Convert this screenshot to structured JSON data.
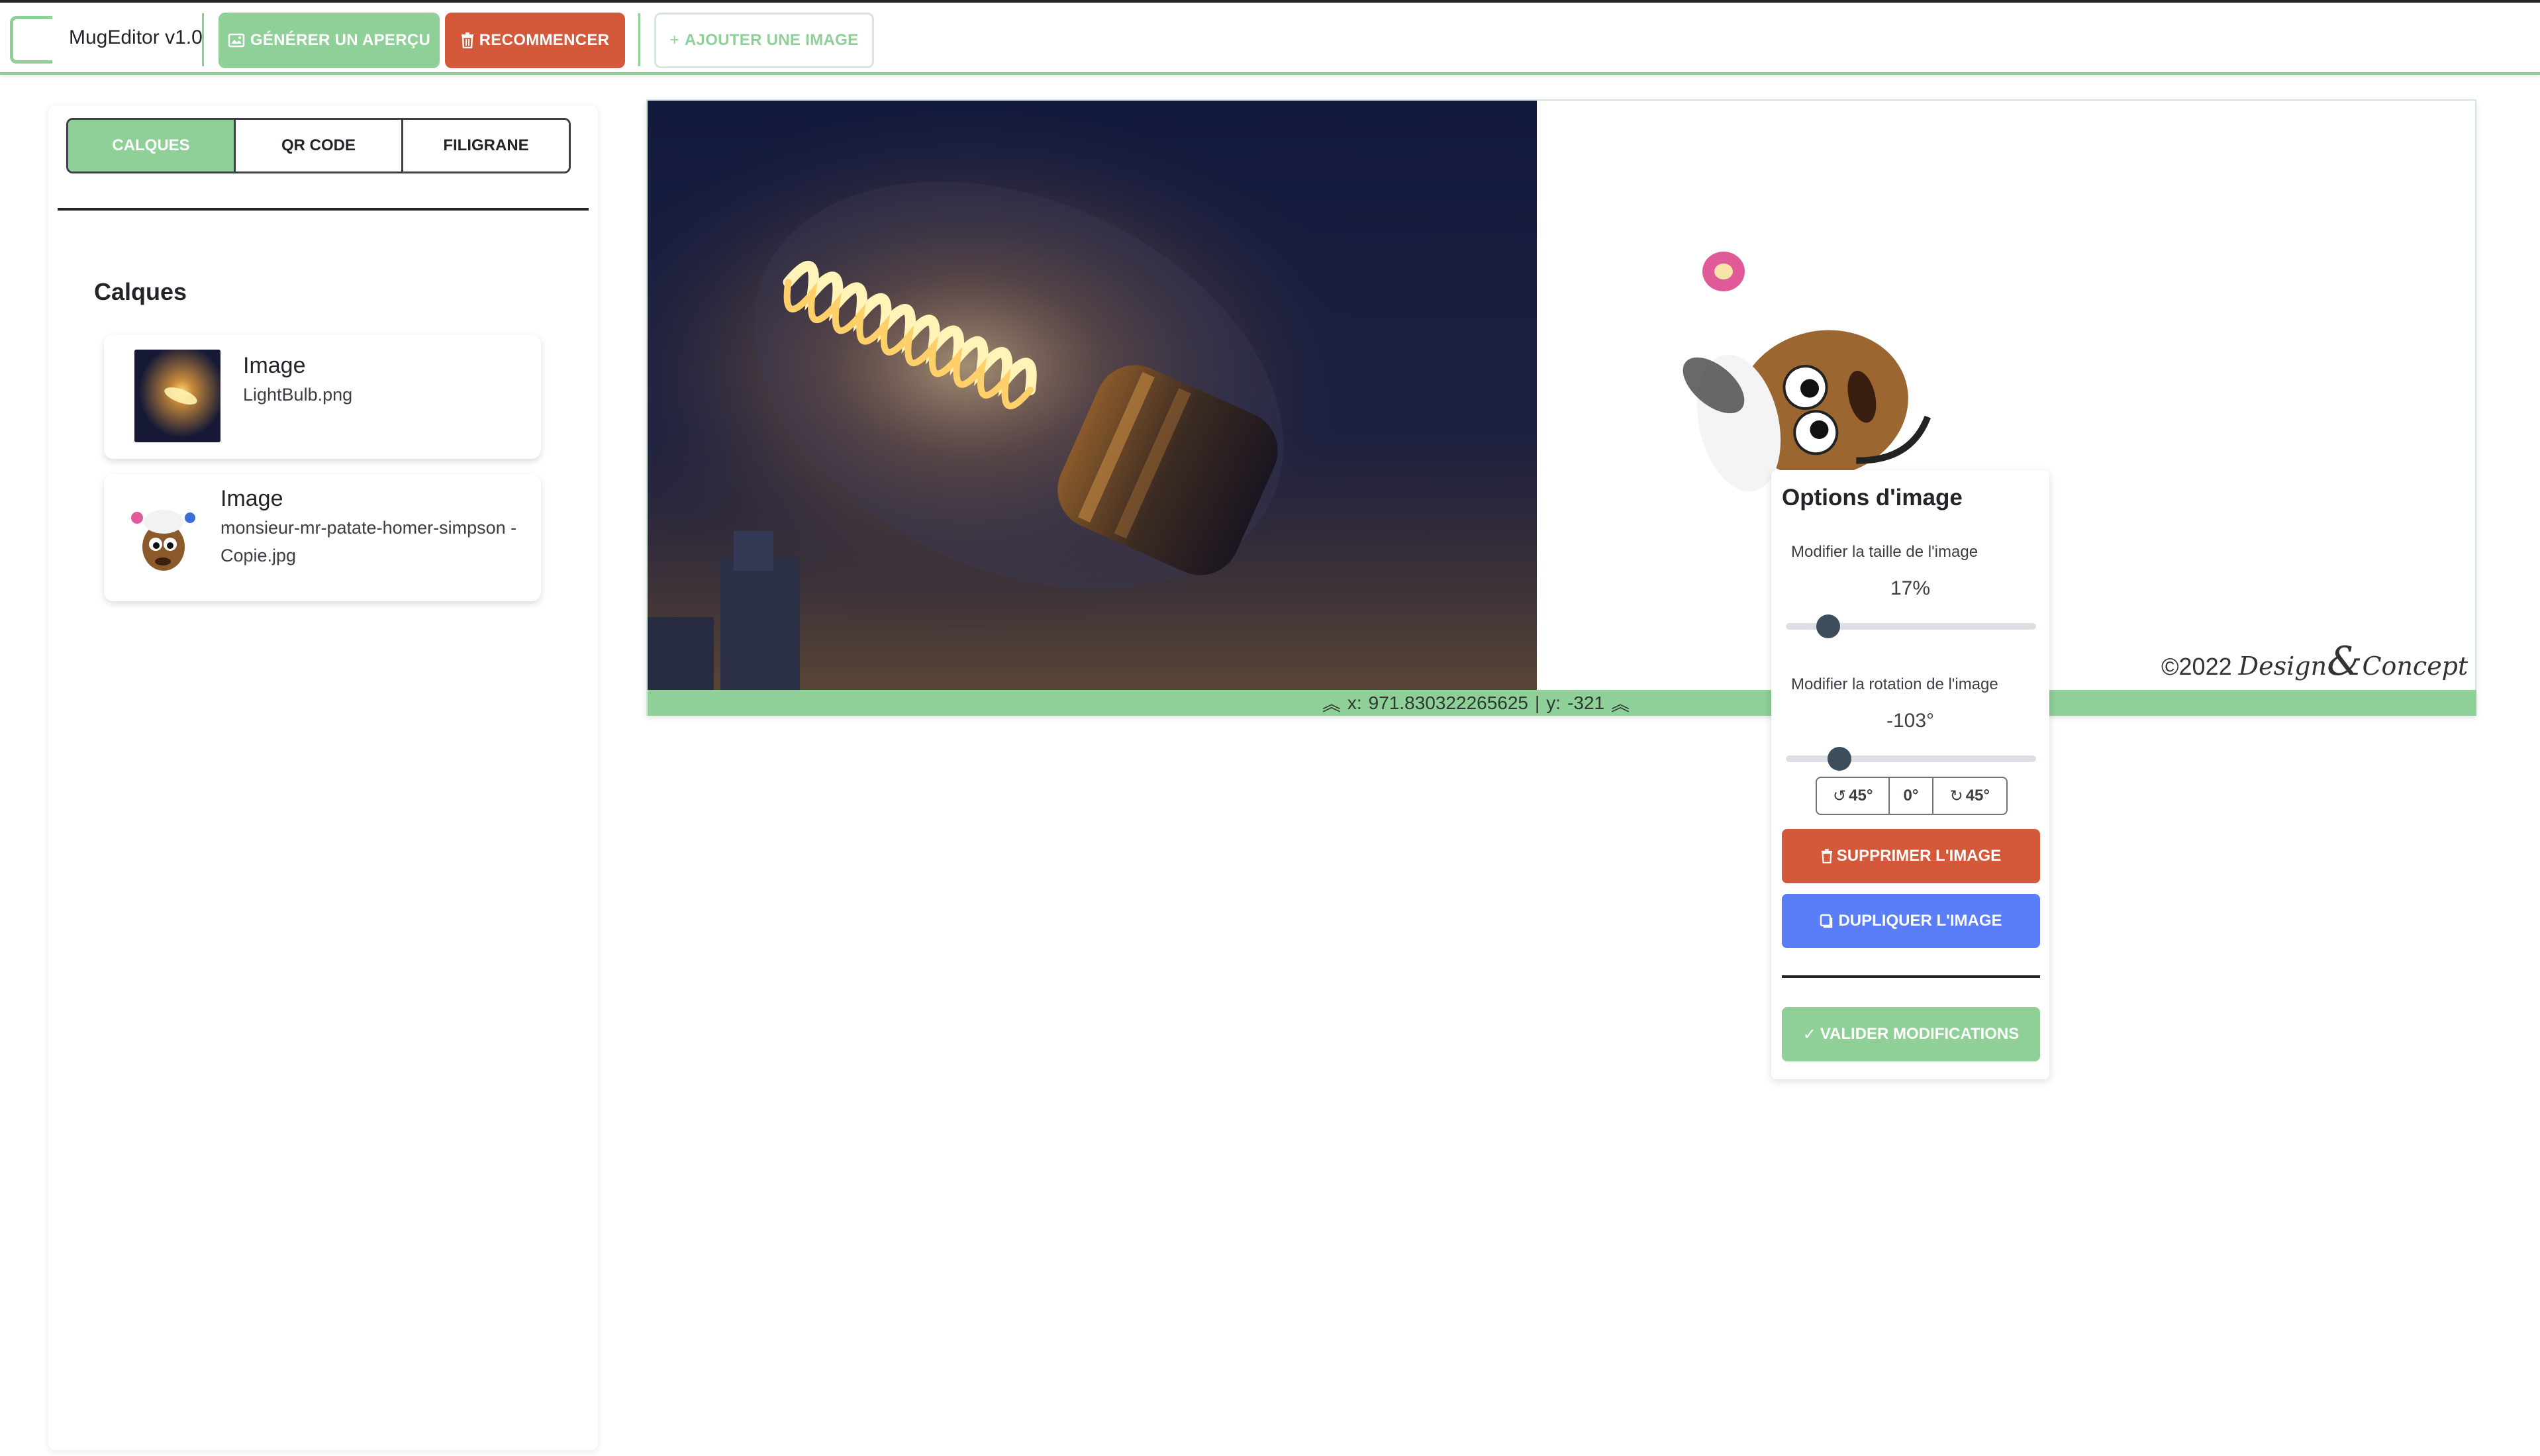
{
  "header": {
    "app_title": "MugEditor v1.0",
    "preview_label": "GÉNÉRER UN APERÇU",
    "reset_label": "RECOMMENCER",
    "add_image_label": "AJOUTER UNE IMAGE",
    "icons": {
      "preview": "image-icon",
      "reset": "trash-icon",
      "add": "plus-icon"
    }
  },
  "sidebar": {
    "tabs": [
      {
        "label": "CALQUES",
        "active": true
      },
      {
        "label": "QR CODE",
        "active": false
      },
      {
        "label": "FILIGRANE",
        "active": false
      }
    ],
    "section_title": "Calques",
    "layers": [
      {
        "type": "Image",
        "filename": "LightBulb.png"
      },
      {
        "type": "Image",
        "filename": "monsieur-mr-patate-homer-simpson - Copie.jpg"
      }
    ]
  },
  "canvas": {
    "status": {
      "x_label": "x:",
      "x_value": "971.830322265625",
      "separator": "|",
      "y_label": "y:",
      "y_value": "-321"
    },
    "watermark": {
      "year": "©2022",
      "word1": "Design",
      "amp": "&",
      "word2": "Concept"
    }
  },
  "options": {
    "title": "Options d'image",
    "size_label": "Modifier la taille de l'image",
    "size_value": "17%",
    "size_fraction": 0.17,
    "rotation_label": "Modifier la rotation de l'image",
    "rotation_value": "-103°",
    "rotation_degrees": -103,
    "rotate_left_label": "45°",
    "rotate_zero_label": "0°",
    "rotate_right_label": "45°",
    "delete_label": "SUPPRIMER L'IMAGE",
    "duplicate_label": "DUPLIQUER L'IMAGE",
    "validate_label": "VALIDER MODIFICATIONS"
  },
  "colors": {
    "accent_green": "#8fcf98",
    "danger_red": "#d4583a",
    "primary_blue": "#5a7ef7"
  }
}
